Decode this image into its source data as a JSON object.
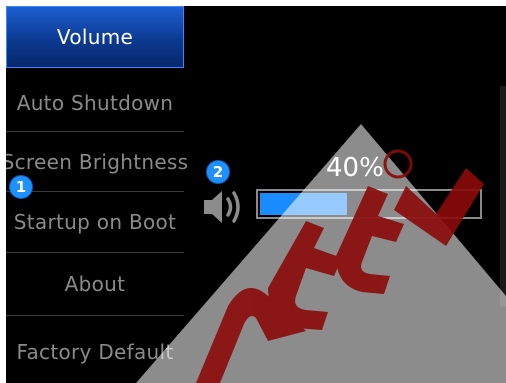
{
  "menu": {
    "items": [
      {
        "label": "Volume",
        "active": true
      },
      {
        "label": "Auto Shutdown",
        "active": false
      },
      {
        "label": "Screen Brightness",
        "active": false
      },
      {
        "label": "Startup on Boot",
        "active": false
      },
      {
        "label": "About",
        "active": false
      },
      {
        "label": "Factory Default",
        "active": false
      }
    ]
  },
  "annotations": {
    "badge_1": "1",
    "badge_2": "2"
  },
  "volume": {
    "value_text": "40%",
    "level": 0.4
  },
  "icons": {
    "speaker": "speaker-volume-icon"
  },
  "colors": {
    "accent": "#1a8cff",
    "active_bg": "#0c3a92",
    "watermark": "#8b0a0a"
  }
}
